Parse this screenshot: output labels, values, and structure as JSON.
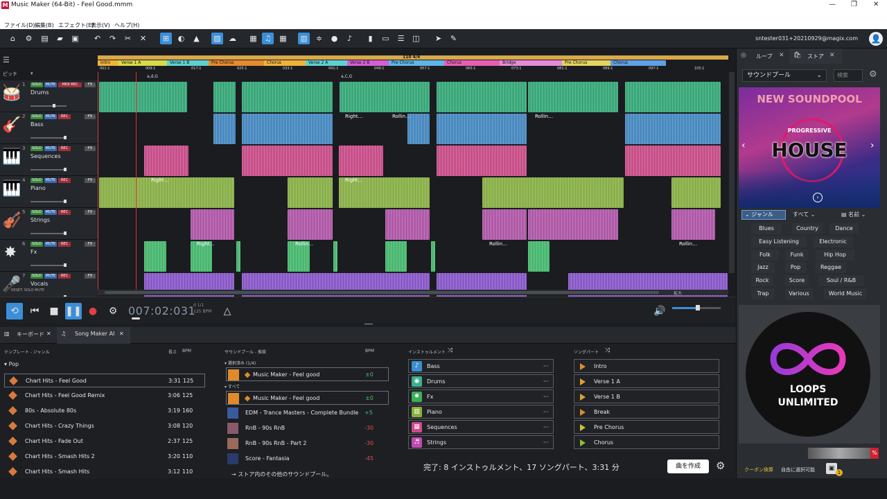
{
  "window": {
    "title": "Music Maker (64-Bit) - Feel Good.mmm",
    "logo": "M"
  },
  "menu": [
    "ファイル(D)",
    "編集(B)",
    "エフェクト(E)",
    "表示(V)",
    "ヘルプ(H)"
  ],
  "account": {
    "email": "sntester031+20210929@magix.com"
  },
  "tracks": [
    {
      "num": "1",
      "name": "Drums",
      "icon": "drums-icon",
      "glyph": "🥁",
      "rec": "MIDI REC"
    },
    {
      "num": "2",
      "name": "Bass",
      "icon": "bass-guitar-icon",
      "glyph": "🎸",
      "rec": "REC"
    },
    {
      "num": "3",
      "name": "Sequences",
      "icon": "sequencer-icon",
      "glyph": "🎹",
      "rec": "REC"
    },
    {
      "num": "4",
      "name": "Piano",
      "icon": "piano-icon",
      "glyph": "🎹",
      "rec": "REC"
    },
    {
      "num": "5",
      "name": "Strings",
      "icon": "violin-icon",
      "glyph": "🎻",
      "rec": "REC"
    },
    {
      "num": "6",
      "name": "Fx",
      "icon": "fx-burst-icon",
      "glyph": "✸",
      "rec": "REC"
    },
    {
      "num": "7",
      "name": "Vocals",
      "icon": "microphone-icon",
      "glyph": "🎤",
      "rec": "REC"
    }
  ],
  "track_buttons": {
    "solo": "SOLO",
    "mute": "MUTE",
    "fx": "FX"
  },
  "header_labels": {
    "pitch": "ピッチ",
    "reset": "RESET: SOLO MUTE"
  },
  "tempo_marker": "110 4/4",
  "markers": [
    {
      "label": "Intro",
      "color": "#f0b23a"
    },
    {
      "label": "Verse 1 A",
      "color": "#d9d94a"
    },
    {
      "label": "Verse 1 B",
      "color": "#5fd0d0"
    },
    {
      "label": "Pre Chorus",
      "color": "#e68a2e"
    },
    {
      "label": "Chorus",
      "color": "#f0b23a"
    },
    {
      "label": "Verse 2 A",
      "color": "#5fd0d0"
    },
    {
      "label": "Verse 2 B",
      "color": "#d45fd4"
    },
    {
      "label": "Pre Chorus",
      "color": "#5fb6e6"
    },
    {
      "label": "Chorus",
      "color": "#e65fb6"
    },
    {
      "label": "Bridge",
      "color": "#e68ad9"
    },
    {
      "label": "Pre Chorus",
      "color": "#e6d45f"
    },
    {
      "label": "Chorus",
      "color": "#5fa0e6"
    }
  ],
  "bars": [
    "001:1",
    "009:1",
    "017:1",
    "025:1",
    "033:1",
    "041:1",
    "049:1",
    "057:1",
    "065:1",
    "073:1",
    "081:1",
    "089:1",
    "097:1",
    "105:1"
  ],
  "chord_labels": [
    "a,d,G",
    "a,C,G"
  ],
  "clip_labels": {
    "right": "Right…",
    "rolling": "Rollin…"
  },
  "transport": {
    "time": "007:02:031",
    "bpm_line1": "d   1/1",
    "bpm_line2": "125 BPM"
  },
  "zoom_label": "拡大",
  "lower_tabs": [
    {
      "label": "キーボード"
    },
    {
      "label": "Song Maker AI"
    }
  ],
  "templates": {
    "header": "テンプレート - ジャンル",
    "len_header": "長さ",
    "bpm_header": "BPM",
    "group": "Pop",
    "items": [
      {
        "name": "Chart Hits - Feel Good",
        "len": "3:31",
        "bpm": "125",
        "selected": true
      },
      {
        "name": "Chart Hits - Feel Good Remix",
        "len": "3:06",
        "bpm": "125"
      },
      {
        "name": "80s - Absolute 80s",
        "len": "3:19",
        "bpm": "160"
      },
      {
        "name": "Chart Hits - Crazy Things",
        "len": "3:08",
        "bpm": "120"
      },
      {
        "name": "Chart Hits - Fade Out",
        "len": "2:37",
        "bpm": "125"
      },
      {
        "name": "Chart Hits - Smash Hits 2",
        "len": "3:20",
        "bpm": "110"
      },
      {
        "name": "Chart Hits - Smash Hits",
        "len": "3:12",
        "bpm": "110"
      }
    ]
  },
  "soundpools": {
    "header": "サウンドプール - 推奨",
    "bpm_header": "BPM",
    "selected_group": "選択済み (1/4)",
    "all_group": "すべて",
    "selected": [
      {
        "name": "Music Maker - Feel good",
        "bpm": "±0"
      }
    ],
    "all": [
      {
        "name": "Music Maker - Feel good",
        "bpm": "±0",
        "color": "#e08a2e"
      },
      {
        "name": "EDM - Trance Masters - Complete Bundle",
        "bpm": "+5",
        "color": "#3a5a9e"
      },
      {
        "name": "RnB - 90s RnB",
        "bpm": "-30",
        "color": "#8a5a6a"
      },
      {
        "name": "RnB - 90s RnB - Part 2",
        "bpm": "-30",
        "color": "#9a6a5a"
      },
      {
        "name": "Score - Fantasia",
        "bpm": "-45",
        "color": "#2a3a6a"
      }
    ],
    "more": "→ ストア内のその他のサウンドプール。"
  },
  "instruments": {
    "header": "インストゥルメント",
    "items": [
      {
        "name": "Bass",
        "color": "#3a8fd0",
        "icon": "bass-guitar-icon",
        "glyph": "♪"
      },
      {
        "name": "Drums",
        "color": "#3ab08a",
        "icon": "drums-icon",
        "glyph": "◉"
      },
      {
        "name": "Fx",
        "color": "#3ab05a",
        "icon": "fx-burst-icon",
        "glyph": "✸"
      },
      {
        "name": "Piano",
        "color": "#8ab03a",
        "icon": "piano-icon",
        "glyph": "▥"
      },
      {
        "name": "Sequences",
        "color": "#d04a8a",
        "icon": "sequencer-icon",
        "glyph": "▦"
      },
      {
        "name": "Strings",
        "color": "#c04ab0",
        "icon": "violin-icon",
        "glyph": "♬"
      }
    ],
    "more_glyph": "···"
  },
  "songparts": {
    "header": "ソングパート",
    "items": [
      {
        "name": "Intro",
        "color": "#e08a2e"
      },
      {
        "name": "Verse 1 A",
        "color": "#e0a02e"
      },
      {
        "name": "Verse 1 B",
        "color": "#e0a02e"
      },
      {
        "name": "Break",
        "color": "#e08a2e"
      },
      {
        "name": "Pre Chorus",
        "color": "#d0c03a"
      },
      {
        "name": "Chorus",
        "color": "#8ac03a"
      }
    ]
  },
  "status": {
    "text": "完了: 8 インストゥルメント、17 ソングパート、3:31 分",
    "create": "曲を作成"
  },
  "right_panel": {
    "tabs": [
      {
        "label": "ループ"
      },
      {
        "label": "ストア"
      }
    ],
    "dropdown": "サウンドプール",
    "search_placeholder": "検索",
    "banner_title": "NEW SOUNDPOOL",
    "banner_sub": "PROGRESSIVE",
    "banner_main": "HOUSE",
    "genre_btn": "ジャンル",
    "all_btn": "すべて",
    "sort_btn": "名前",
    "genres": [
      "Blues",
      "Country",
      "Dance",
      "Easy Listening",
      "Electronic",
      "Folk",
      "Funk",
      "Hip Hop",
      "Jazz",
      "Pop",
      "Reggae",
      "Rock",
      "Score",
      "Soul / R&B",
      "Trap",
      "Various",
      "World Music"
    ],
    "loops_line1": "LOOPS",
    "loops_line2": "UNLIMITED",
    "coupon": "クーポン換算",
    "free_select": "自由に選択可能",
    "badge": "1"
  }
}
